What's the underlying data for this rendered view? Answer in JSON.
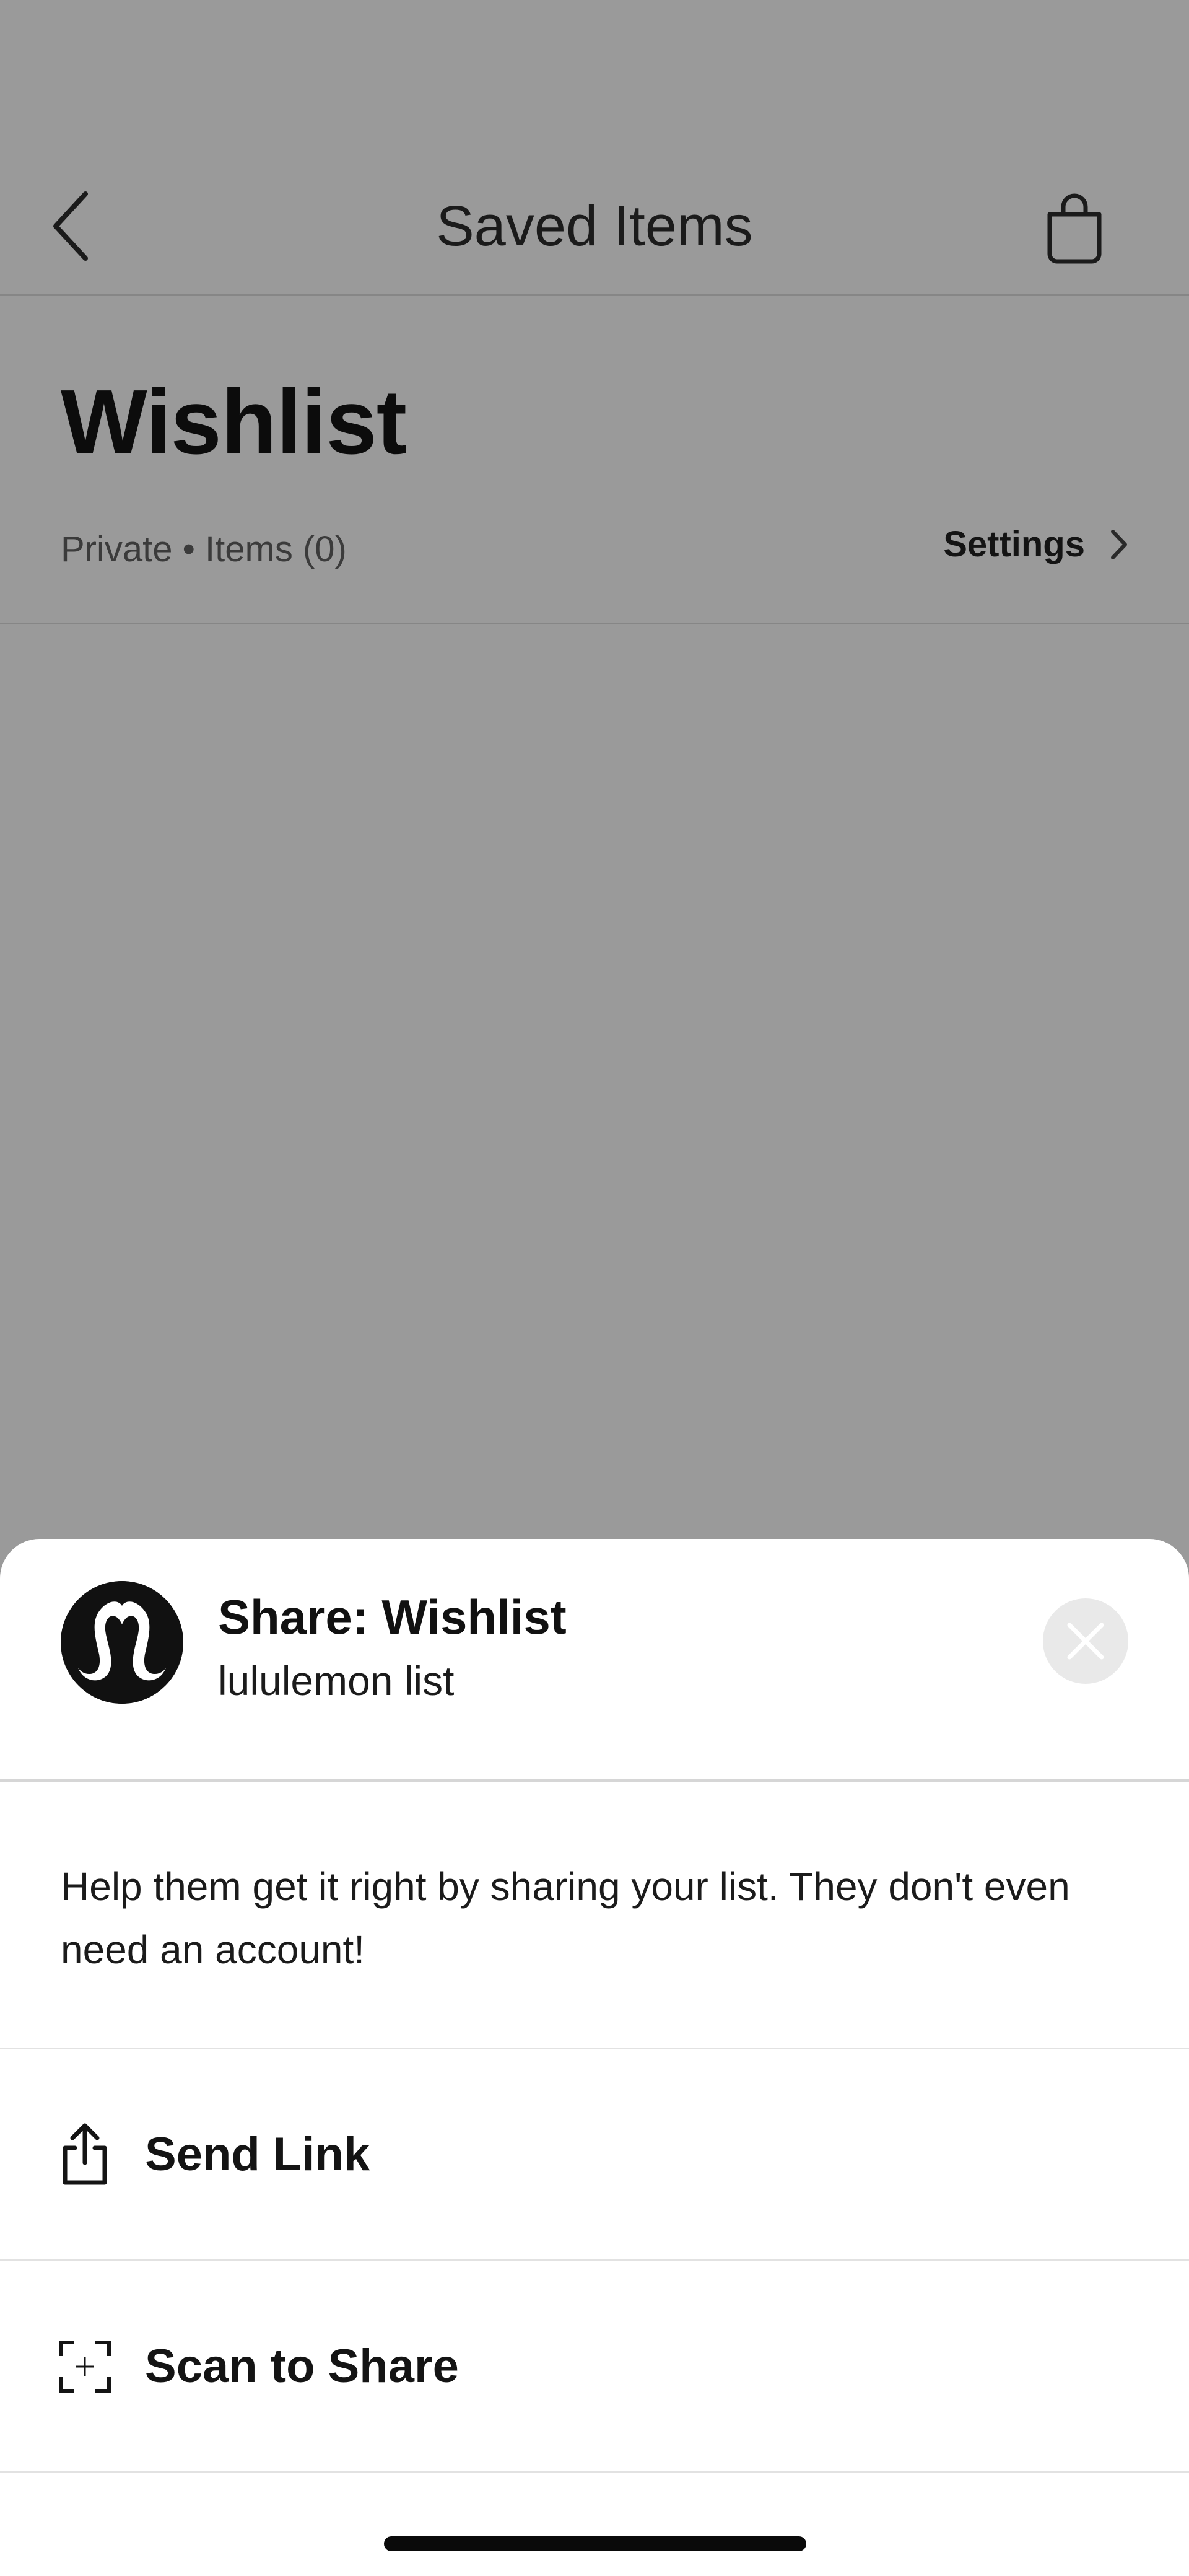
{
  "header": {
    "title": "Saved Items",
    "back_icon": "chevron-left-icon",
    "bag_icon": "shopping-bag-icon"
  },
  "list": {
    "title": "Wishlist",
    "meta": "Private • Items (0)",
    "settings_label": "Settings",
    "settings_icon": "chevron-right-icon"
  },
  "share_sheet": {
    "logo_icon": "lululemon-logo-icon",
    "title": "Share: Wishlist",
    "subtitle": "lululemon list",
    "close_icon": "close-icon",
    "description": "Help them get it right by sharing your list. They don't even need an account!",
    "actions": [
      {
        "label": "Send Link",
        "icon": "share-icon"
      },
      {
        "label": "Scan to Share",
        "icon": "scan-icon"
      }
    ]
  },
  "colors": {
    "overlay_background": "#9a9a9a",
    "sheet_background": "#ffffff",
    "text_primary": "#111111",
    "close_button_bg": "#e9e9e9"
  }
}
